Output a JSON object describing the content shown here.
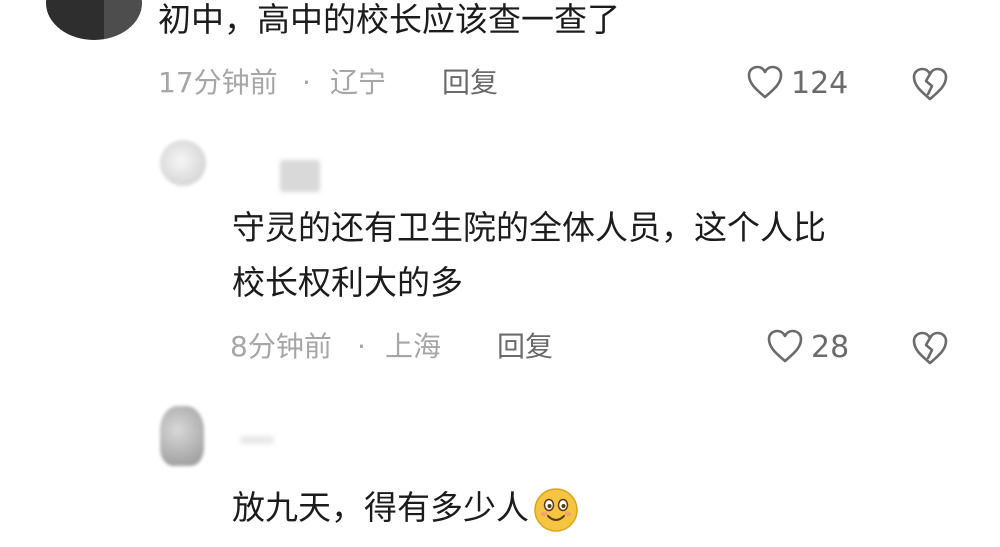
{
  "comments": [
    {
      "text": "初中，高中的校长应该查一查了",
      "time": "17分钟前",
      "separator": "·",
      "location": "辽宁",
      "reply_label": "回复",
      "like_count": "124"
    },
    {
      "text_line1": "守灵的还有卫生院的全体人员，这个人比",
      "text_line2": "校长权利大的多",
      "time": "8分钟前",
      "separator": "·",
      "location": "上海",
      "reply_label": "回复",
      "like_count": "28"
    },
    {
      "text": "放九天，得有多少人",
      "emoji": "smile-emoji"
    }
  ],
  "icons": {
    "like": "heart-outline-icon",
    "dislike": "broken-heart-icon"
  },
  "colors": {
    "text": "#1c1c1c",
    "meta": "#a6a6a6",
    "action": "#6b6b6b",
    "emoji": "#f5c542"
  }
}
